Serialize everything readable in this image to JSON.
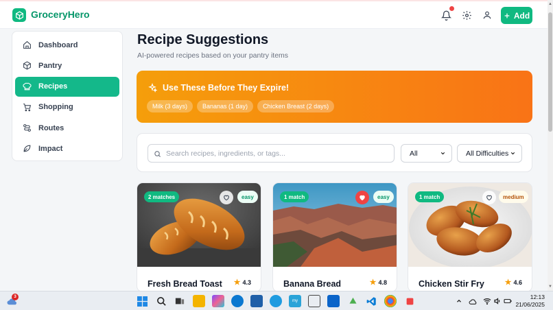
{
  "app": {
    "name": "GroceryHero"
  },
  "header": {
    "add_label": "Add"
  },
  "sidebar": {
    "items": [
      {
        "label": "Dashboard",
        "icon": "home-icon"
      },
      {
        "label": "Pantry",
        "icon": "box-icon"
      },
      {
        "label": "Recipes",
        "icon": "chef-hat-icon",
        "active": true
      },
      {
        "label": "Shopping",
        "icon": "cart-icon"
      },
      {
        "label": "Routes",
        "icon": "route-icon"
      },
      {
        "label": "Impact",
        "icon": "leaf-icon"
      }
    ]
  },
  "main": {
    "title": "Recipe Suggestions",
    "subtitle": "AI-powered recipes based on your pantry items",
    "expiring": {
      "title": "Use These Before They Expire!",
      "items": [
        "Milk (3 days)",
        "Bananas (1 day)",
        "Chicken Breast (2 days)"
      ]
    },
    "search": {
      "placeholder": "Search recipes, ingredients, or tags...",
      "category_value": "All",
      "difficulty_value": "All Difficulties"
    },
    "recipes": [
      {
        "title": "Fresh Bread Toast",
        "matches": "2 matches",
        "difficulty": "easy",
        "rating": "4.3",
        "liked": false
      },
      {
        "title": "Banana Bread",
        "matches": "1 match",
        "difficulty": "easy",
        "rating": "4.8",
        "liked": true
      },
      {
        "title": "Chicken Stir Fry",
        "matches": "1 match",
        "difficulty": "medium",
        "rating": "4.6",
        "liked": false
      }
    ]
  },
  "taskbar": {
    "weather_badge": "3",
    "time": "12:13",
    "date": "21/06/2025"
  },
  "colors": {
    "brand": "#10b981",
    "warning": "#f59e0b",
    "liked": "#ef4444"
  }
}
